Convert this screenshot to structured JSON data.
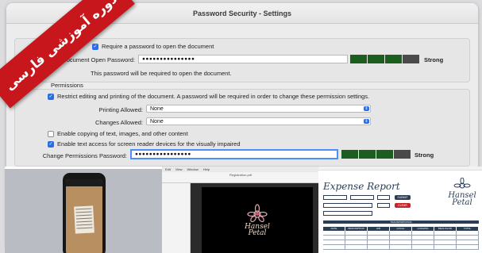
{
  "dialog": {
    "title": "Password Security - Settings",
    "open_section_text": "Require a password to open the document",
    "open_password_label": "Document Open Password:",
    "open_password_value": "●●●●●●●●●●●●●●●",
    "open_strength": "Strong",
    "open_note": "This password will be required to open the document.",
    "permissions_header": "Permissions",
    "restrict_text": "Restrict editing and printing of the document. A password will be required in order to change these permission settings.",
    "printing_label": "Printing Allowed:",
    "printing_value": "None",
    "changes_label": "Changes Allowed:",
    "changes_value": "None",
    "copy_text": "Enable copying of text, images, and other content",
    "screenreader_text": "Enable text access for screen reader devices for the visually impaired",
    "change_perm_label": "Change Permissions Password:",
    "change_perm_value": "●●●●●●●●●●●●●●●●",
    "change_strength": "Strong"
  },
  "ribbon": {
    "text": "دوره آموزشی فارسی",
    "color": "#c8161d"
  },
  "thumb_pdf": {
    "menu": [
      "Edit",
      "View",
      "Window",
      "Help"
    ],
    "doc_title": "Registration.pdf",
    "brand": "Hansel Petal"
  },
  "thumb_report": {
    "title": "Expense Report",
    "submit_label": "SUBMIT",
    "clear_label": "CLEAR",
    "section_label": "TRANSPORTATION",
    "columns": [
      "DATE",
      "DESCRIPTION",
      "AIR",
      "LOCAL",
      "LODGING",
      "MEALS/LOD",
      "TOTAL"
    ],
    "brand": "Hansel Petal"
  },
  "colors": {
    "meter_on": "#1b5e20",
    "meter_off": "#4a4a4a",
    "accent": "#2b6de8"
  }
}
